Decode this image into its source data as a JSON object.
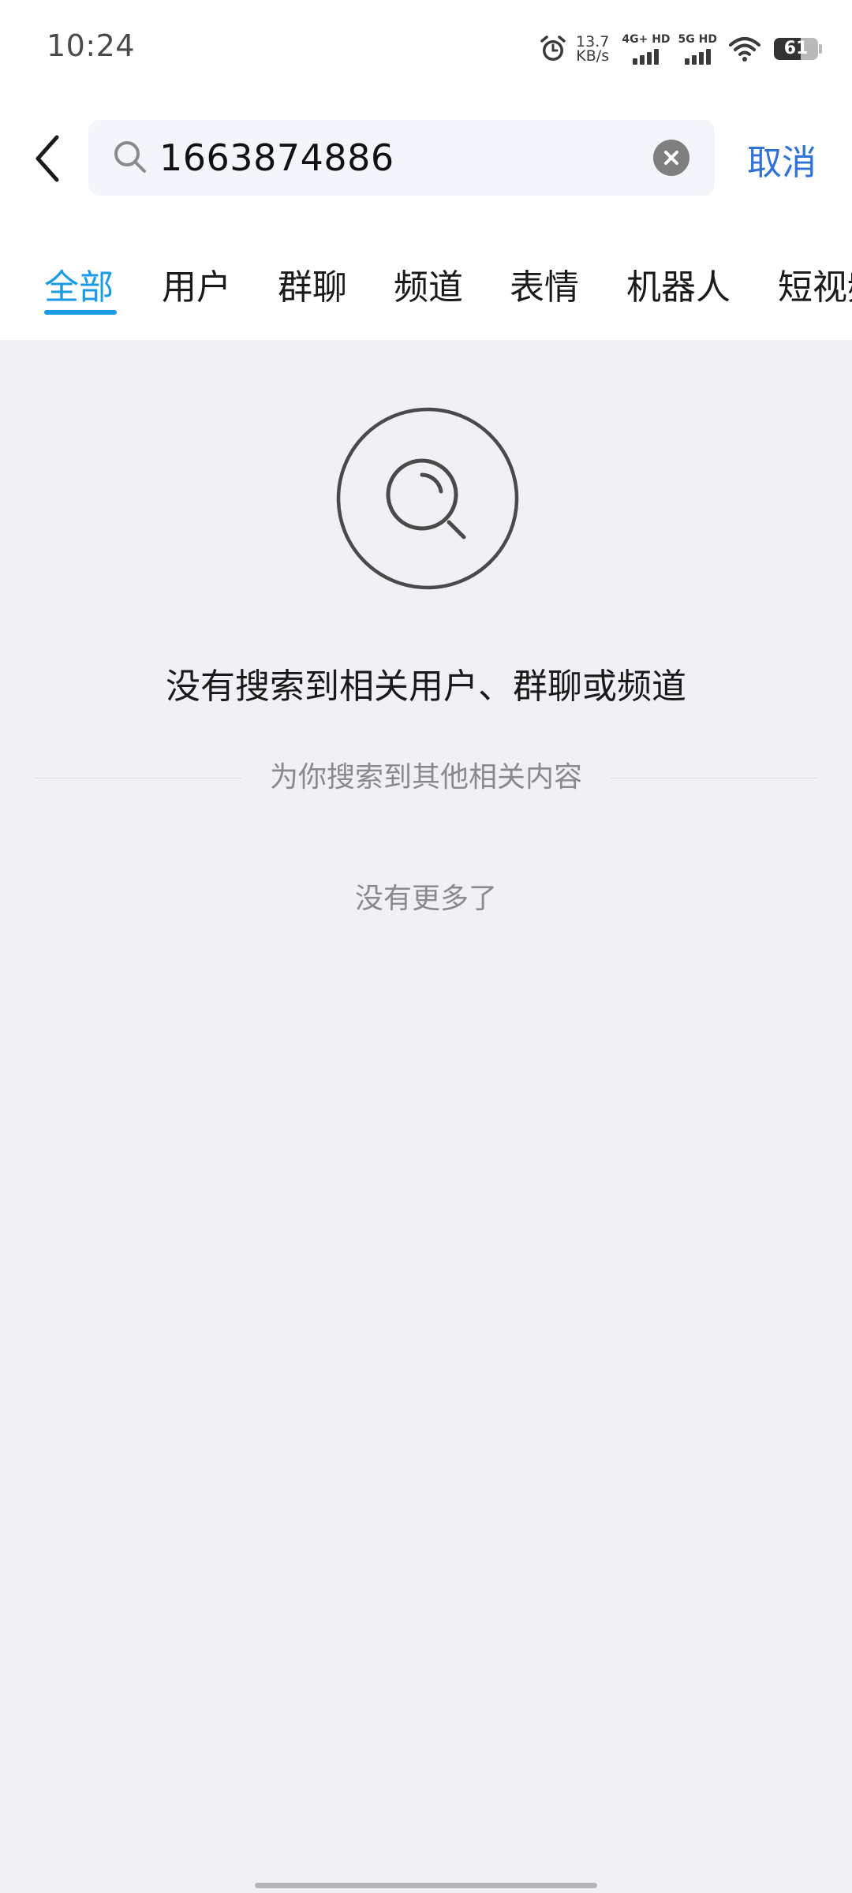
{
  "status_bar": {
    "time": "10:24",
    "speed_value": "13.7",
    "speed_unit": "KB/s",
    "sim1_label": "4G+ HD",
    "sim2_label": "5G HD",
    "battery": "61",
    "battery_level": 0.61
  },
  "search": {
    "query": "1663874886",
    "cancel_label": "取消"
  },
  "tabs": [
    {
      "label": "全部",
      "active": true
    },
    {
      "label": "用户",
      "active": false
    },
    {
      "label": "群聊",
      "active": false
    },
    {
      "label": "频道",
      "active": false
    },
    {
      "label": "表情",
      "active": false
    },
    {
      "label": "机器人",
      "active": false
    },
    {
      "label": "短视频",
      "active": false
    }
  ],
  "empty_state": {
    "title": "没有搜索到相关用户、群聊或频道",
    "related_divider": "为你搜索到其他相关内容",
    "no_more": "没有更多了"
  },
  "colors": {
    "accent": "#1b9ae6",
    "cancel": "#2f73d8",
    "background": "#f0f0f5"
  }
}
